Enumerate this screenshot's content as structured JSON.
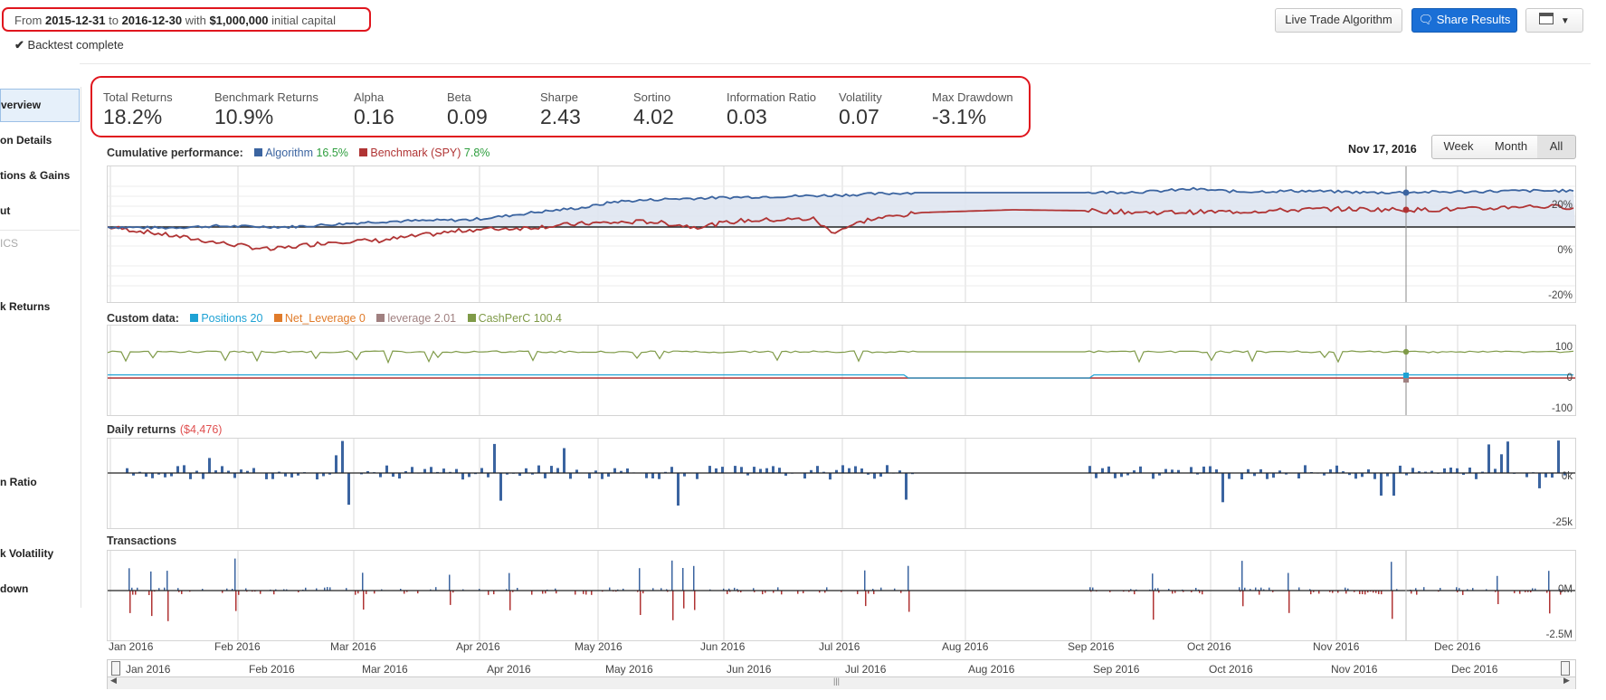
{
  "header": {
    "from_label": "From",
    "start_date": "2015-12-31",
    "to_label": "to",
    "end_date": "2016-12-30",
    "with_label": "with",
    "capital": "$1,000,000",
    "capital_suffix": "initial capital",
    "status": "Backtest complete"
  },
  "toolbar": {
    "live_trade_label": "Live Trade Algorithm",
    "share_label": "Share Results"
  },
  "sidebar": {
    "items": [
      {
        "label": "verview",
        "active": true
      },
      {
        "label": "on Details"
      },
      {
        "label": "tions & Gains"
      },
      {
        "label": "ut"
      },
      {
        "label": "ICS"
      },
      {
        "label": "k Returns"
      },
      {
        "label": "n Ratio"
      },
      {
        "label": "k Volatility"
      },
      {
        "label": "down"
      }
    ]
  },
  "metrics": [
    {
      "label": "Total Returns",
      "value": "18.2%"
    },
    {
      "label": "Benchmark Returns",
      "value": "10.9%"
    },
    {
      "label": "Alpha",
      "value": "0.16"
    },
    {
      "label": "Beta",
      "value": "0.09"
    },
    {
      "label": "Sharpe",
      "value": "2.43"
    },
    {
      "label": "Sortino",
      "value": "4.02"
    },
    {
      "label": "Information Ratio",
      "value": "0.03"
    },
    {
      "label": "Volatility",
      "value": "0.07"
    },
    {
      "label": "Max Drawdown",
      "value": "-3.1%"
    }
  ],
  "cumulative": {
    "title": "Cumulative performance:",
    "algo_name": "Algorithm",
    "algo_value": "16.5%",
    "bench_name": "Benchmark (SPY)",
    "bench_value": "7.8%",
    "date": "Nov 17, 2016",
    "range_buttons": [
      "Week",
      "Month",
      "All"
    ],
    "active_range": "All",
    "y_labels": [
      "20%",
      "0%",
      "-20%"
    ]
  },
  "custom": {
    "title": "Custom data:",
    "items": [
      {
        "name": "Positions",
        "value": "20",
        "color": "#1ea2d4"
      },
      {
        "name": "Net_Leverage",
        "value": "0",
        "color": "#e07b2a"
      },
      {
        "name": "leverage",
        "value": "2.01",
        "color": "#a08080"
      },
      {
        "name": "CashPerC",
        "value": "100.4",
        "color": "#7f9a48"
      }
    ],
    "y_labels": [
      "100",
      "0",
      "-100"
    ]
  },
  "daily": {
    "title": "Daily returns",
    "value": "($4,476)",
    "y_labels": [
      "0k",
      "-25k"
    ]
  },
  "transactions": {
    "title": "Transactions",
    "y_labels": [
      "0M",
      "-2.5M"
    ]
  },
  "months": [
    "Jan 2016",
    "Feb 2016",
    "Mar 2016",
    "Apr 2016",
    "May 2016",
    "Jun 2016",
    "Jul 2016",
    "Aug 2016",
    "Sep 2016",
    "Oct 2016",
    "Nov 2016",
    "Dec 2016"
  ],
  "colors": {
    "algorithm": "#3b64a0",
    "benchmark": "#b03434",
    "accent": "#1a6fd6",
    "highlight": "#e0161e",
    "positive_value": "#2e9e3e",
    "negative_value": "#e05050"
  }
}
